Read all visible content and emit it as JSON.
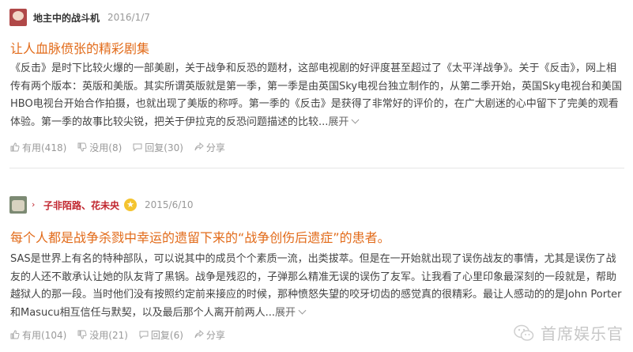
{
  "reviews": [
    {
      "author": "地主中的战斗机",
      "date": "2016/1/7",
      "title": "让人血脉偾张的精彩剧集",
      "body": "《反击》是时下比较火爆的一部美剧，关于战争和反恐的题材，这部电视剧的好评度甚至超过了《太平洋战争》。关于《反击》，网上相传有两个版本：英版和美版。其实所谓英版就是第一季，第一季是由英国Sky电视台独立制作的，从第二季开始，英国Sky电视台和美国HBO电视台开始合作拍摄，也就出现了美版的称呼。第一季的《反击》是获得了非常好的评价的，在广大剧迷的心中留下了完美的观看体验。第一季的故事比较尖锐，把关于伊拉克的反恐问题描述的比较...",
      "expand": "展开",
      "useful": "有用(418)",
      "useless": "没用(8)",
      "reply": "回复(30)",
      "share": "分享"
    },
    {
      "author": "子非陌路、花未央",
      "date": "2015/6/10",
      "title": "每个人都是战争杀戮中幸运的遗留下来的“战争创伤后遗症”的患者。",
      "body": "SAS是世界上有名的特种部队，可以说其中的成员个个素质一流，出类拔萃。但是在一开始就出现了误伤战友的事情，尤其是误伤了战友的人还不敢承认让她的队友背了黑锅。战争是残忍的，子弹那么精准无误的误伤了友军。让我看了心里印象最深刻的一段就是，帮助越狱人的那一段。当时他们没有按照约定前来接应的时候，那种愤怒失望的咬牙切齿的感觉真的很精彩。最让人感动的的是John Porter和Masucu相互信任与默契，以及最后那个人离开前两人...",
      "expand": "展开",
      "useful": "有用(104)",
      "useless": "没用(21)",
      "reply": "回复(6)",
      "share": "分享"
    }
  ],
  "watermark": "首席娱乐官",
  "colors": {
    "title": "#e26b1a",
    "author_highlight": "#c0252e",
    "meta": "#999999"
  }
}
